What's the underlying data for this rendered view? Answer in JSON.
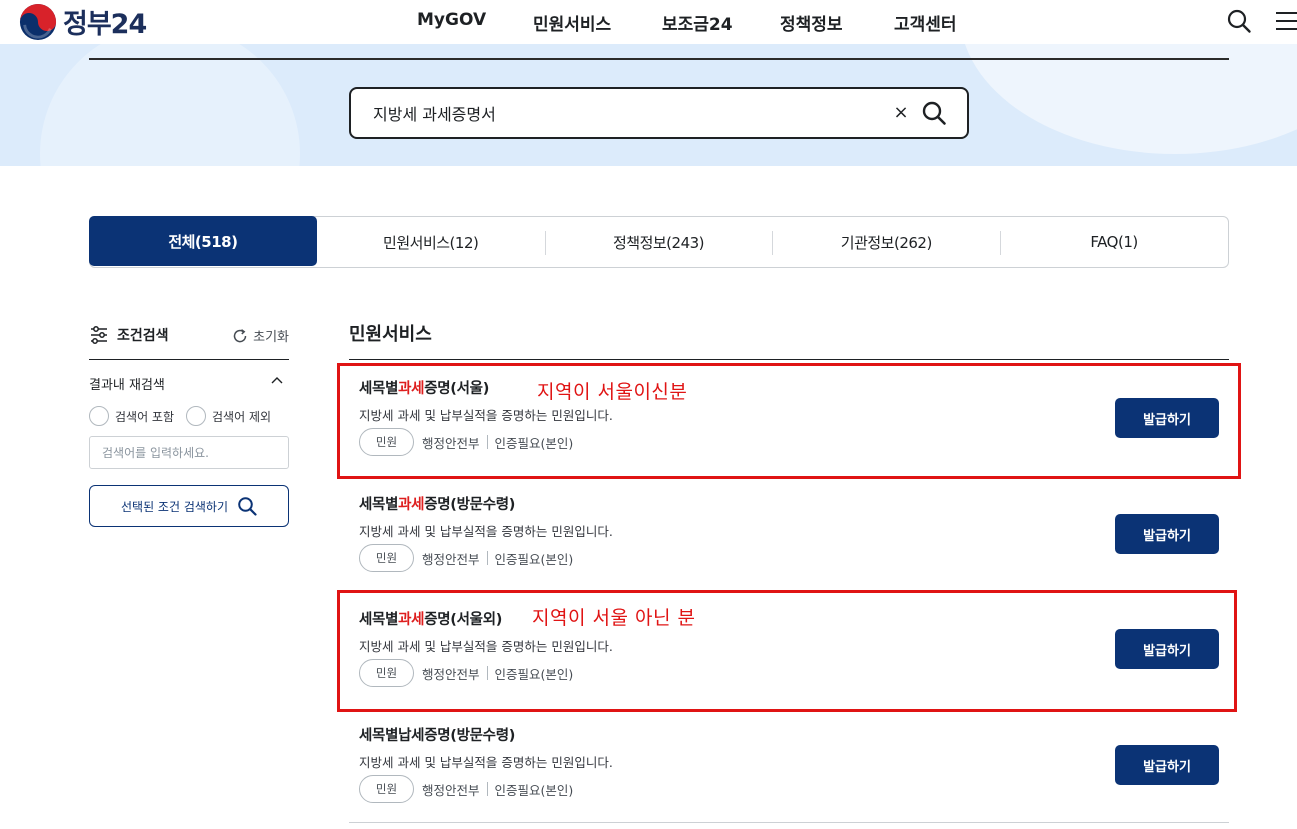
{
  "header": {
    "logo_text": "정부24",
    "nav": [
      "MyGOV",
      "민원서비스",
      "보조금24",
      "정책정보",
      "고객센터"
    ],
    "icons": {
      "search": "search-icon",
      "menu": "hamburger-menu-icon"
    }
  },
  "search": {
    "value": "지방세 과세증명서",
    "clear_symbol": "×"
  },
  "tabs": [
    {
      "label": "전체(518)",
      "active": true
    },
    {
      "label": "민원서비스(12)",
      "active": false
    },
    {
      "label": "정책정보(243)",
      "active": false
    },
    {
      "label": "기관정보(262)",
      "active": false
    },
    {
      "label": "FAQ(1)",
      "active": false
    }
  ],
  "filter": {
    "title": "조건검색",
    "reset_label": "초기화",
    "refine_label": "결과내 재검색",
    "include_label": "검색어 포함",
    "exclude_label": "검색어 제외",
    "input_placeholder": "검색어를 입력하세요.",
    "apply_label": "선택된 조건 검색하기"
  },
  "results": {
    "section_title": "민원서비스",
    "items": [
      {
        "title_pre": "세목별",
        "title_hl": "과세",
        "title_post": "증명(서울)",
        "desc": "지방세 과세 및 납부실적을 증명하는 민원입니다.",
        "chip": "민원",
        "org": "행정안전부",
        "auth": "인증필요(본인)",
        "button": "발급하기"
      },
      {
        "title_pre": "세목별",
        "title_hl": "과세",
        "title_post": "증명(방문수령)",
        "desc": "지방세 과세 및 납부실적을 증명하는 민원입니다.",
        "chip": "민원",
        "org": "행정안전부",
        "auth": "인증필요(본인)",
        "button": "발급하기"
      },
      {
        "title_pre": "세목별",
        "title_hl": "과세",
        "title_post": "증명(서울외)",
        "desc": "지방세 과세 및 납부실적을 증명하는 민원입니다.",
        "chip": "민원",
        "org": "행정안전부",
        "auth": "인증필요(본인)",
        "button": "발급하기"
      },
      {
        "title_pre": "세목별납세증명(방문수령)",
        "title_hl": "",
        "title_post": "",
        "desc": "지방세 과세 및 납부실적을 증명하는 민원입니다.",
        "chip": "민원",
        "org": "행정안전부",
        "auth": "인증필요(본인)",
        "button": "발급하기"
      }
    ]
  },
  "annotations": {
    "note_1": "지역이 서울이신분",
    "note_2": "지역이 서울 아닌 분",
    "color": "#e01414"
  },
  "colors": {
    "primary": "#0b3375",
    "highlight": "#de1e1e",
    "banner": "#dcebfb"
  }
}
